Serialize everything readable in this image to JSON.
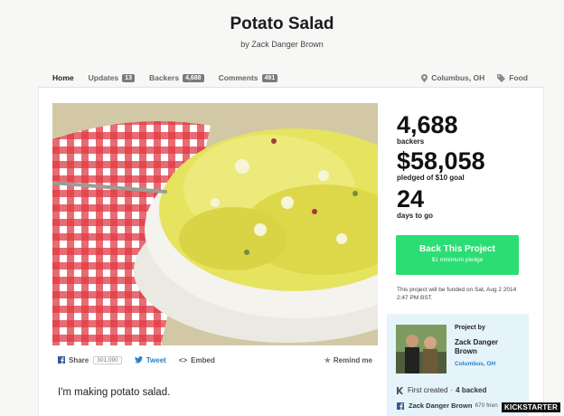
{
  "project": {
    "title": "Potato Salad",
    "byline": "by Zack Danger Brown"
  },
  "nav": {
    "tabs": [
      {
        "label": "Home",
        "count": null
      },
      {
        "label": "Updates",
        "count": "13"
      },
      {
        "label": "Backers",
        "count": "4,688"
      },
      {
        "label": "Comments",
        "count": "491"
      }
    ],
    "location": "Columbus, OH",
    "category": "Food",
    "location_icon": "map-pin-icon",
    "category_icon": "tag-icon"
  },
  "stats": {
    "backers": "4,688",
    "backers_label": "backers",
    "pledged": "$58,058",
    "pledged_label": "pledged of $10 goal",
    "days": "24",
    "days_label": "days to go"
  },
  "cta": {
    "label": "Back This Project",
    "sub": "$1 minimum pledge",
    "color": "#2bde73"
  },
  "funding_note": "This project will be funded on Sat, Aug 2 2014 2:47 PM BST.",
  "creator": {
    "heading": "Project by",
    "name": "Zack Danger Brown",
    "location": "Columbus, OH",
    "first_created": "First created",
    "backed": "4 backed",
    "fb_name": "Zack Danger Brown",
    "fb_friends": "670 frien"
  },
  "share": {
    "share_label": "Share",
    "share_count": "301,090",
    "tweet_label": "Tweet",
    "embed_label": "Embed",
    "remind_label": "Remind me"
  },
  "blurb": "I'm making potato salad.",
  "watermark": "KICKSTARTER"
}
